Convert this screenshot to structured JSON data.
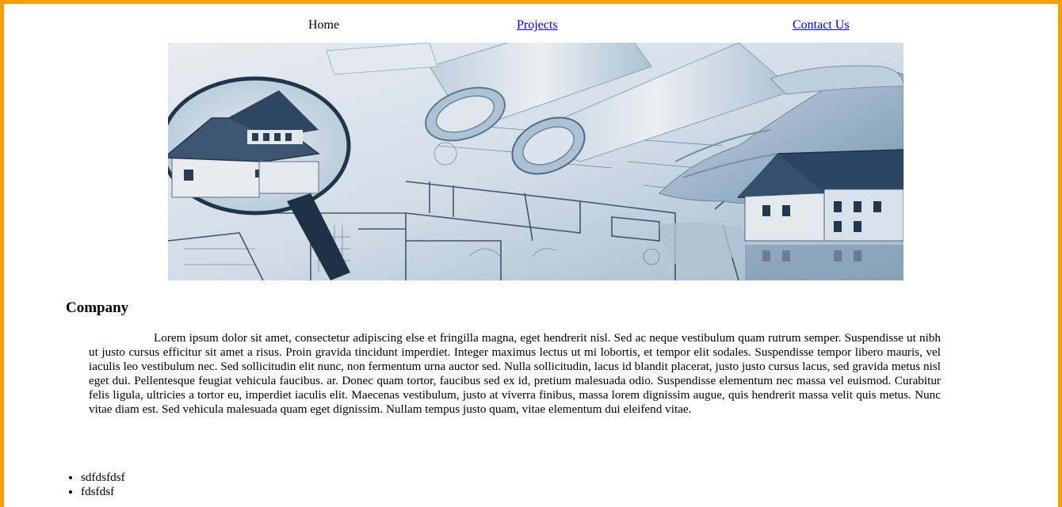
{
  "nav": {
    "home_label": "Home",
    "projects_label": "Projects",
    "contact_label": "Contact Us"
  },
  "banner": {
    "alt": "Architectural blueprints, magnifying glass over a house model, rolled plans and a hand over a house model"
  },
  "company": {
    "heading": "Company",
    "body": "Lorem ipsum dolor sit amet, consectetur adipiscing else et fringilla magna, eget hendrerit nisl. Sed ac neque vestibulum quam rutrum semper. Suspendisse ut nibh ut justo cursus efficitur sit amet a risus. Proin gravida tincidunt imperdiet. Integer maximus lectus ut mi lobortis, et tempor elit sodales. Suspendisse tempor libero mauris, vel iaculis leo vestibulum nec. Sed sollicitudin elit nunc, non fermentum urna auctor sed. Nulla sollicitudin, lacus id blandit placerat, justo justo cursus lacus, sed gravida metus nisl eget dui. Pellentesque feugiat vehicula faucibus. ar. Donec quam tortor, faucibus sed ex id, pretium malesuada odio. Suspendisse elementum nec massa vel euismod. Curabitur felis ligula, ultricies a tortor eu, imperdiet iaculis elit. Maecenas vestibulum, justo at viverra finibus, massa lorem dignissim augue, quis hendrerit massa velit quis metus. Nunc vitae diam est. Sed vehicula malesuada quam eget dignissim. Nullam tempus justo quam, vitae elementum dui eleifend vitae."
  },
  "list": {
    "items": [
      "sdfdsfdsf",
      "fdsfdsf"
    ]
  },
  "colors": {
    "page_border": "#f5a000",
    "link": "#0000ee",
    "banner_tint": "#2c5b82"
  }
}
